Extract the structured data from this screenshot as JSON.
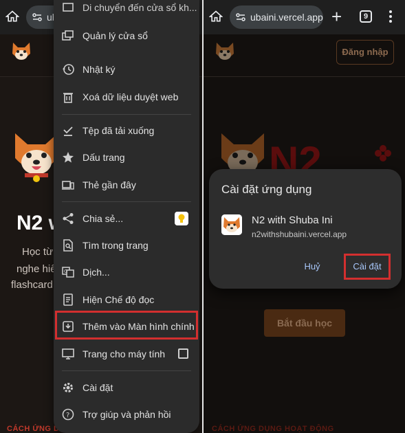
{
  "left": {
    "url_fragment": "ub",
    "menu_top_partial": "Di chuyển đến cửa sổ kh...",
    "menu": [
      {
        "id": "window-manager",
        "label": "Quản lý cửa sổ",
        "icon": "window-manager-icon"
      },
      {
        "id": "history",
        "label": "Nhật ký",
        "icon": "history-icon"
      },
      {
        "id": "clear-data",
        "label": "Xoá dữ liệu duyệt web",
        "icon": "trash-icon"
      },
      {
        "id": "downloads",
        "label": "Tệp đã tải xuống",
        "icon": "download-check-icon"
      },
      {
        "id": "bookmarks",
        "label": "Dấu trang",
        "icon": "star-icon"
      },
      {
        "id": "recent-tabs",
        "label": "Thẻ gần đây",
        "icon": "devices-icon"
      },
      {
        "id": "share",
        "label": "Chia sẻ...",
        "icon": "share-icon"
      },
      {
        "id": "find",
        "label": "Tìm trong trang",
        "icon": "find-in-page-icon"
      },
      {
        "id": "translate",
        "label": "Dịch...",
        "icon": "translate-icon"
      },
      {
        "id": "reader",
        "label": "Hiện Chế độ đọc",
        "icon": "reader-mode-icon"
      },
      {
        "id": "add-home",
        "label": "Thêm vào Màn hình chính",
        "icon": "add-to-home-icon"
      },
      {
        "id": "desktop-site",
        "label": "Trang cho máy tính",
        "icon": "desktop-icon"
      },
      {
        "id": "settings",
        "label": "Cài đặt",
        "icon": "gear-icon"
      },
      {
        "id": "help",
        "label": "Trợ giúp và phản hồi",
        "icon": "help-icon"
      }
    ],
    "hero_title": "N2 w",
    "hero_lines": [
      "Học từ",
      "nghe hiể",
      "flashcard"
    ],
    "footer": "CÁCH ỨNG DỤNG HOẠT ĐỘNG"
  },
  "right": {
    "url": "ubaini.vercel.app",
    "tab_count": "9",
    "login": "Đăng nhập",
    "n2": "N2",
    "start": "Bắt đầu học",
    "footer": "CÁCH ỨNG DỤNG HOẠT ĐỘNG",
    "dialog": {
      "title": "Cài đặt ứng dụng",
      "app_name": "N2 with Shuba Ini",
      "app_url": "n2withshubaini.vercel.app",
      "cancel": "Huỷ",
      "install": "Cài đặt"
    }
  },
  "colors": {
    "highlight": "#d32f2f",
    "menu_bg": "#2b2b2b",
    "accent_link": "#a8c7fa"
  }
}
